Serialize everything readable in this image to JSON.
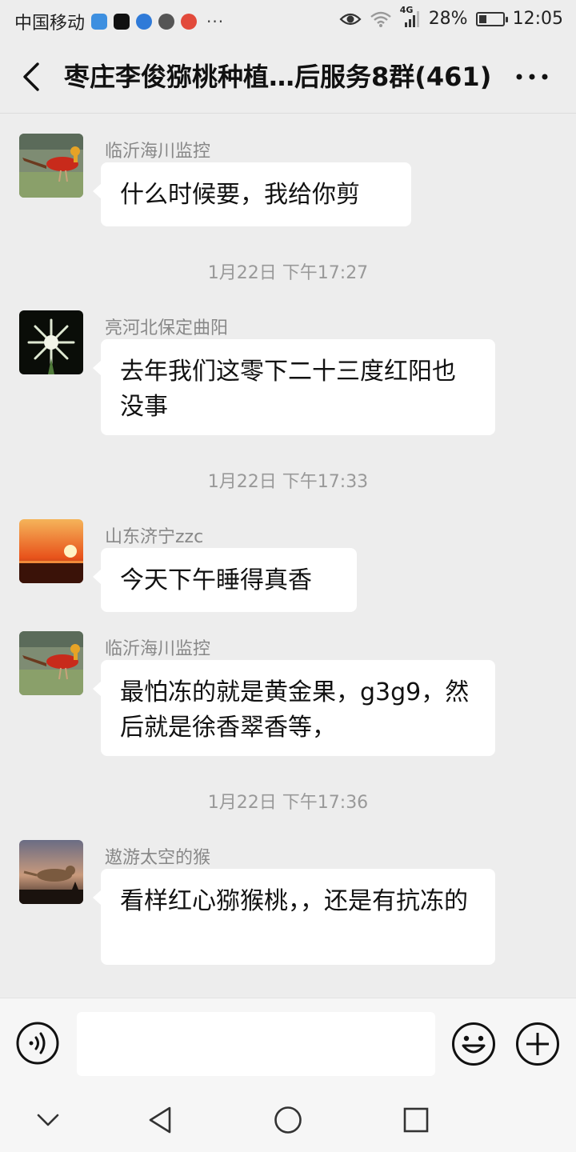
{
  "status_bar": {
    "carrier": "中国移动",
    "more_dots": "···",
    "network": "4G",
    "battery": "28%",
    "battery_level": 0.28,
    "time": "12:05"
  },
  "header": {
    "title": "枣庄李俊猕桃种植…后服务8群(461)"
  },
  "messages": [
    {
      "sender": "临沂海川监控",
      "text": "什么时候要，我给你剪"
    },
    {
      "timestamp": "1月22日 下午17:27"
    },
    {
      "sender": "亮河北保定曲阳",
      "text": "去年我们这零下二十三度红阳也没事"
    },
    {
      "timestamp": "1月22日 下午17:33"
    },
    {
      "sender": "山东济宁zzc",
      "text": "今天下午睡得真香"
    },
    {
      "sender": "临沂海川监控",
      "text": "最怕冻的就是黄金果，g3g9，然后就是徐香翠香等，"
    },
    {
      "timestamp": "1月22日 下午17:36"
    },
    {
      "sender": "遨游太空的猴",
      "text": "看样红心猕猴桃，，还是有抗冻的"
    }
  ],
  "input": {
    "value": ""
  },
  "colors": {
    "background": "#ededed",
    "bubble": "#ffffff",
    "sender_text": "#888888",
    "timestamp_text": "#999999"
  }
}
